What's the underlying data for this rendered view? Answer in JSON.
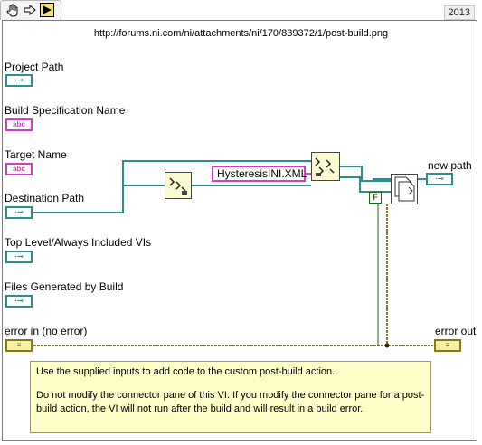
{
  "toolbar": {
    "tools": [
      "hand-icon",
      "arrow-right-icon",
      "run-arrow-icon"
    ],
    "version": "2013"
  },
  "diagram": {
    "url": "http://forums.ni.com/ni/attachments/ni/170/839372/1/post-build.png",
    "string_constant": "HysteresisINI.XML",
    "false_constant": "F",
    "note": {
      "line1": "Use the supplied inputs to add code to the custom post-build action.",
      "line2": "Do not modify the connector pane of this VI.  If you modify the connector pane for a post-build action, the VI will not run after the build and will result in a build error."
    }
  },
  "terminals": {
    "project_path": "Project Path",
    "build_spec_name": "Build Specification Name",
    "target_name": "Target Name",
    "destination_path": "Destination Path",
    "top_level_vis": "Top Level/Always Included VIs",
    "files_generated": "Files Generated by Build",
    "error_in": "error in (no error)",
    "new_path": "new path",
    "error_out": "error out"
  },
  "badges": {
    "path": "·⊸",
    "string": "abc",
    "error": "≡"
  },
  "colors": {
    "path_wire": "#2c8f8f",
    "string_wire": "#d33cc6",
    "error_wire": "#8a7a10",
    "note_bg": "#fdfdc8"
  }
}
